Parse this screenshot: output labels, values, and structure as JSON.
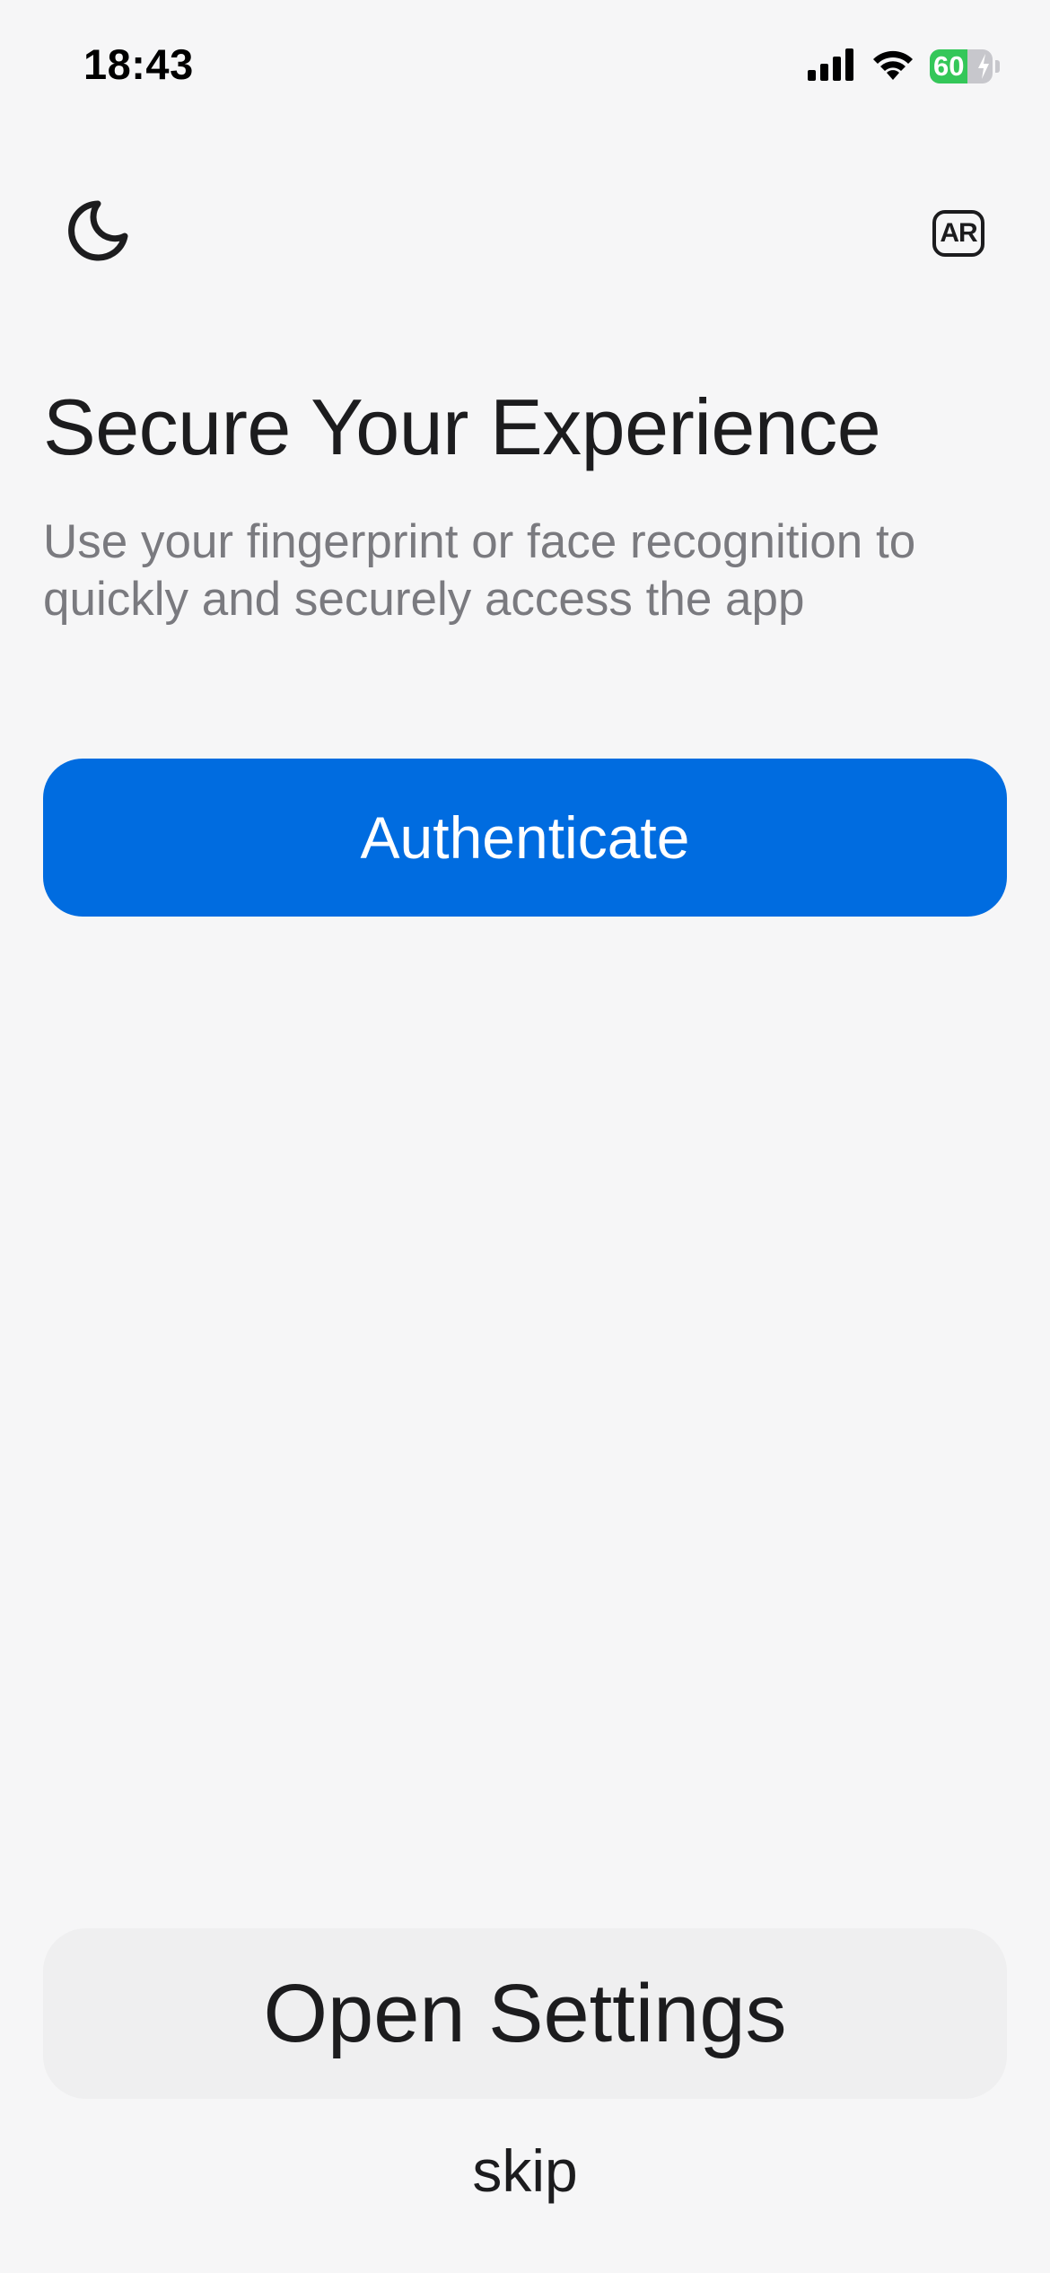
{
  "status_bar": {
    "time": "18:43",
    "battery_percent": 60,
    "battery_label": "60",
    "signal_icon": "cellular-signal-icon",
    "wifi_icon": "wifi-icon",
    "battery_icon": "battery-charging-icon"
  },
  "header": {
    "theme_icon": "moon-icon",
    "language_label": "AR"
  },
  "main": {
    "title": "Secure Your Experience",
    "subtitle": "Use your fingerprint or face recognition to quickly and securely access the app",
    "authenticate_label": "Authenticate"
  },
  "footer": {
    "open_settings_label": "Open Settings",
    "skip_label": "skip"
  },
  "colors": {
    "background": "#f6f6f7",
    "primary": "#006ce0",
    "secondary_button": "#efeff0",
    "text": "#1c1c1e",
    "subtitle_text": "#7a7a7f",
    "battery_green": "#34c759"
  }
}
